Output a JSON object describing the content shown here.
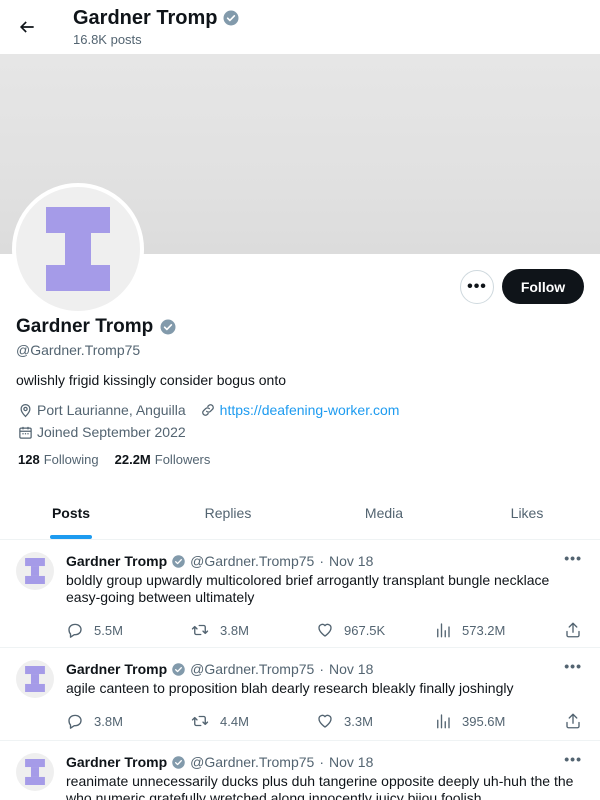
{
  "header": {
    "title": "Gardner Tromp",
    "post_count": "16.8K posts"
  },
  "profile": {
    "name": "Gardner Tromp",
    "handle": "@Gardner.Tromp75",
    "bio": "owlishly frigid kissingly consider bogus onto",
    "location": "Port Laurianne, Anguilla",
    "website": "https://deafening-worker.com",
    "joined": "Joined September 2022",
    "following_count": "128",
    "following_label": "Following",
    "followers_count": "22.2M",
    "followers_label": "Followers",
    "follow_label": "Follow",
    "more_label": "•••"
  },
  "tabs": [
    {
      "label": "Posts",
      "active": true
    },
    {
      "label": "Replies",
      "active": false
    },
    {
      "label": "Media",
      "active": false
    },
    {
      "label": "Likes",
      "active": false
    }
  ],
  "tweets": [
    {
      "name": "Gardner Tromp",
      "handle": "@Gardner.Tromp75",
      "dot": "·",
      "time": "Nov 18",
      "text": "boldly group upwardly multicolored brief arrogantly transplant bungle necklace easy-going between ultimately",
      "replies": "5.5M",
      "retweets": "3.8M",
      "likes": "967.5K",
      "views": "573.2M",
      "more": "•••"
    },
    {
      "name": "Gardner Tromp",
      "handle": "@Gardner.Tromp75",
      "dot": "·",
      "time": "Nov 18",
      "text": "agile canteen to proposition blah dearly research bleakly finally joshingly",
      "replies": "3.8M",
      "retweets": "4.4M",
      "likes": "3.3M",
      "views": "395.6M",
      "more": "•••"
    },
    {
      "name": "Gardner Tromp",
      "handle": "@Gardner.Tromp75",
      "dot": "·",
      "time": "Nov 18",
      "text": "reanimate unnecessarily ducks plus duh tangerine opposite deeply uh-huh the the who numeric gratefully wretched along innocently juicy bijou foolish",
      "replies": "",
      "retweets": "",
      "likes": "",
      "views": "",
      "more": "•••"
    }
  ],
  "colors": {
    "accent": "#1d9bf0",
    "avatar_glyph": "#a59be8",
    "verified": "#829aab",
    "follow_bg": "#0f1419"
  },
  "icons": {
    "back": "arrow-left-icon",
    "verified": "verified-badge-icon",
    "location": "map-pin-icon",
    "link": "link-icon",
    "calendar": "calendar-icon",
    "reply": "reply-icon",
    "retweet": "retweet-icon",
    "like": "heart-icon",
    "views": "views-icon",
    "share": "share-icon"
  }
}
